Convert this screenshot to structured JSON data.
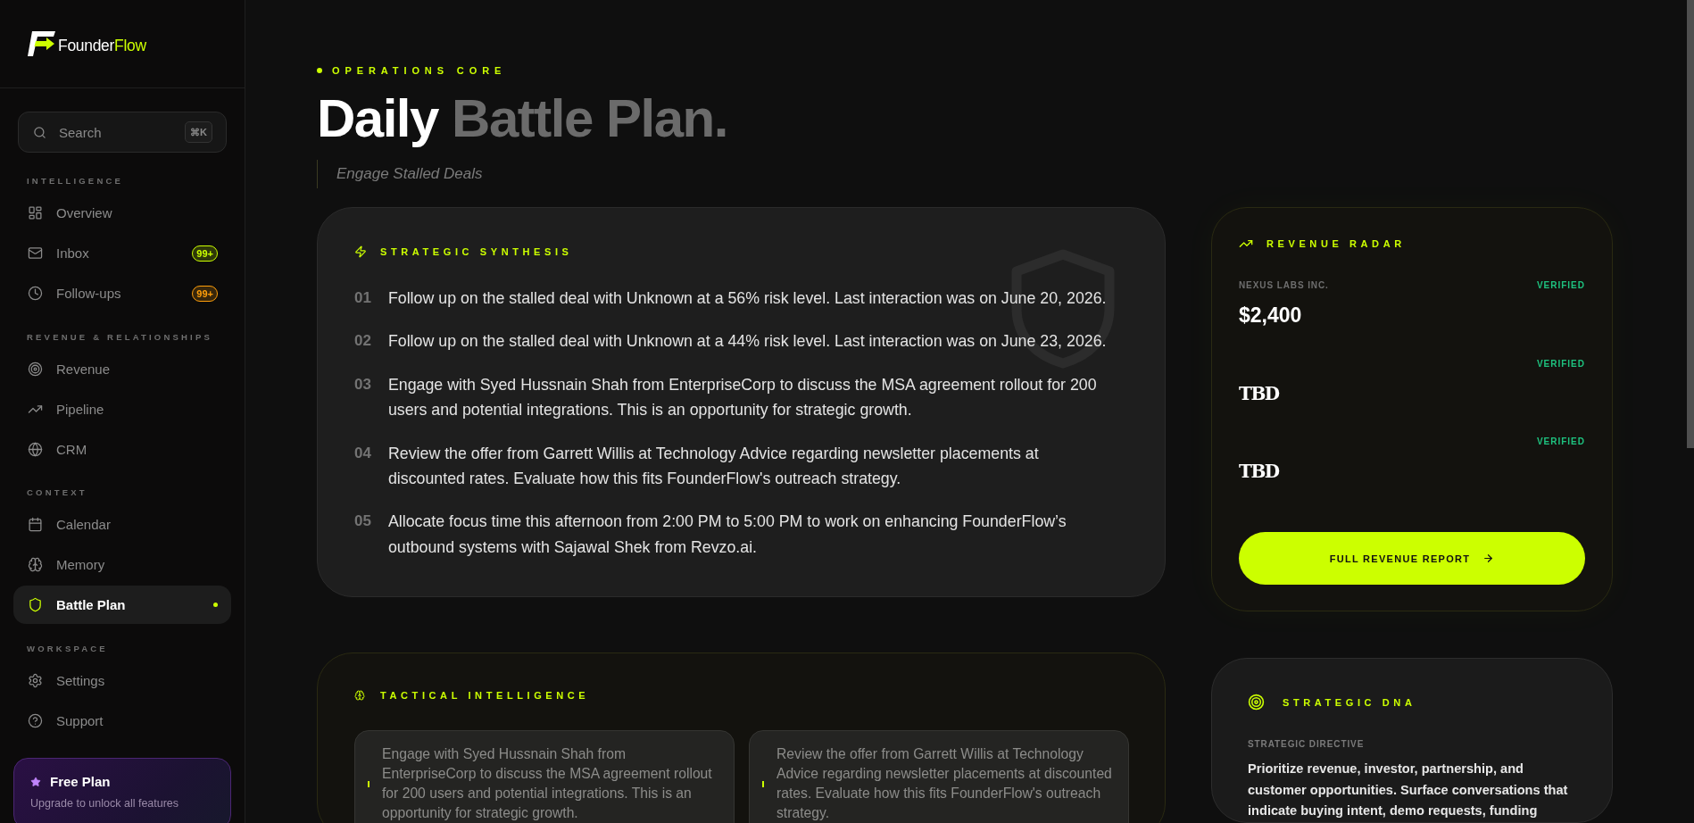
{
  "sidebar": {
    "logo": {
      "name_lead": "Founder",
      "name_accent": "Flow"
    },
    "search": {
      "placeholder": "Search",
      "shortcut": "⌘K"
    },
    "sections": [
      {
        "label": "INTELLIGENCE",
        "items": [
          {
            "label": "Overview",
            "selected": false
          },
          {
            "label": "Inbox",
            "selected": false,
            "badge": "99+",
            "color": "#ccff00"
          },
          {
            "label": "Follow-ups",
            "selected": false,
            "badge": "99+",
            "color": "#ff9f0a"
          }
        ]
      },
      {
        "label": "REVENUE & RELATIONSHIPS",
        "items": [
          {
            "label": "Revenue",
            "selected": false
          },
          {
            "label": "Pipeline",
            "selected": false
          },
          {
            "label": "CRM",
            "selected": false
          }
        ]
      },
      {
        "label": "CONTEXT",
        "items": [
          {
            "label": "Calendar",
            "selected": false
          },
          {
            "label": "Memory",
            "selected": false
          },
          {
            "label": "Battle Plan",
            "selected": true
          }
        ]
      },
      {
        "label": "WORKSPACE",
        "items": [
          {
            "label": "Settings",
            "selected": false
          },
          {
            "label": "Support",
            "selected": false
          }
        ]
      }
    ],
    "plan": {
      "title": "Free Plan",
      "description": "Upgrade to unlock all features"
    }
  },
  "header": {
    "eyebrow": "OPERATIONS CORE",
    "title_lead": "Daily",
    "title_rest": "Battle Plan.",
    "subtitle": "Engage Stalled Deals"
  },
  "synthesis": {
    "title": "STRATEGIC SYNTHESIS",
    "items": [
      {
        "number": "01",
        "text": "Follow up on the stalled deal with Unknown at a 56% risk level. Last interaction was on June 20, 2026."
      },
      {
        "number": "02",
        "text": "Follow up on the stalled deal with Unknown at a 44% risk level. Last interaction was on June 23, 2026."
      },
      {
        "number": "03",
        "text": "Engage with Syed Hussnain Shah from EnterpriseCorp to discuss the MSA agreement rollout for 200 users and potential integrations. This is an opportunity for strategic growth."
      },
      {
        "number": "04",
        "text": "Review the offer from Garrett Willis at Technology Advice regarding newsletter placements at discounted rates. Evaluate how this fits FounderFlow's outreach strategy."
      },
      {
        "number": "05",
        "text": "Allocate focus time this afternoon from 2:00 PM to 5:00 PM to work on enhancing FounderFlow’s outbound systems with Sajawal Shek from Revzo.ai."
      }
    ]
  },
  "revenue_radar": {
    "title": "REVENUE RADAR",
    "entries": [
      {
        "kind": "amount",
        "company": "NEXUS LABS INC.",
        "status": "VERIFIED",
        "value": "$2,400"
      },
      {
        "kind": "pending",
        "status": "VERIFIED",
        "value": "TBD"
      },
      {
        "kind": "pending",
        "status": "VERIFIED",
        "value": "TBD"
      }
    ],
    "button": "FULL REVENUE REPORT"
  },
  "tactical": {
    "title": "TACTICAL INTELLIGENCE",
    "insights": [
      "Engage with Syed Hussnain Shah from EnterpriseCorp to discuss the MSA agreement rollout for 200 users and potential integrations. This is an opportunity for strategic growth.",
      "Review the offer from Garrett Willis at Technology Advice regarding newsletter placements at discounted rates. Evaluate how this fits FounderFlow's outreach strategy."
    ]
  },
  "dna": {
    "title": "STRATEGIC DNA",
    "directive_label": "STRATEGIC DIRECTIVE",
    "directive": "Prioritize revenue, investor, partnership, and customer opportunities. Surface conversations that indicate buying intent, demo requests, funding"
  }
}
